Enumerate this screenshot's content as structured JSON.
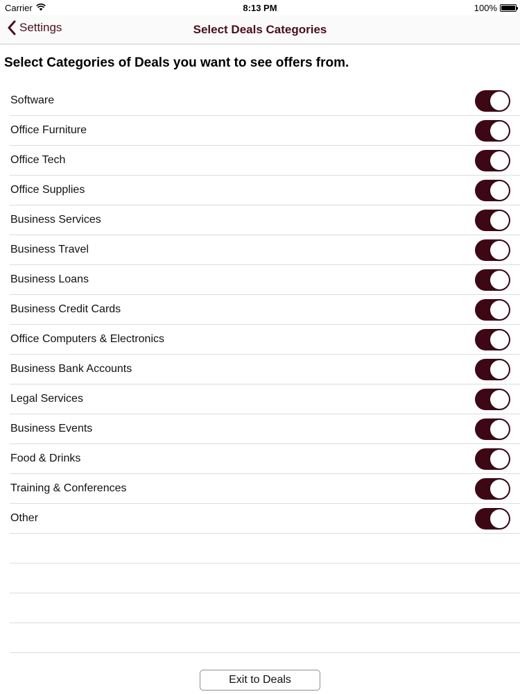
{
  "status_bar": {
    "carrier": "Carrier",
    "time": "8:13 PM",
    "battery": "100%",
    "wifi_icon": "wifi-icon",
    "battery_icon": "battery-icon"
  },
  "nav": {
    "back_label": "Settings",
    "back_icon": "chevron-left-icon",
    "title": "Select Deals Categories"
  },
  "heading": "Select Categories of Deals you want to see offers from.",
  "categories": [
    {
      "label": "Software",
      "enabled": true
    },
    {
      "label": "Office Furniture",
      "enabled": true
    },
    {
      "label": "Office Tech",
      "enabled": true
    },
    {
      "label": "Office Supplies",
      "enabled": true
    },
    {
      "label": "Business Services",
      "enabled": true
    },
    {
      "label": "Business Travel",
      "enabled": true
    },
    {
      "label": "Business Loans",
      "enabled": true
    },
    {
      "label": "Business Credit Cards",
      "enabled": true
    },
    {
      "label": "Office Computers & Electronics",
      "enabled": true
    },
    {
      "label": "Business Bank Accounts",
      "enabled": true
    },
    {
      "label": "Legal Services",
      "enabled": true
    },
    {
      "label": "Business Events",
      "enabled": true
    },
    {
      "label": "Food & Drinks",
      "enabled": true
    },
    {
      "label": "Training & Conferences",
      "enabled": true
    },
    {
      "label": "Other",
      "enabled": true
    }
  ],
  "exit_button_label": "Exit to Deals",
  "colors": {
    "accent": "#4a0e1c",
    "toggle_on": "#3d0716",
    "separator": "#dcdcdc"
  }
}
